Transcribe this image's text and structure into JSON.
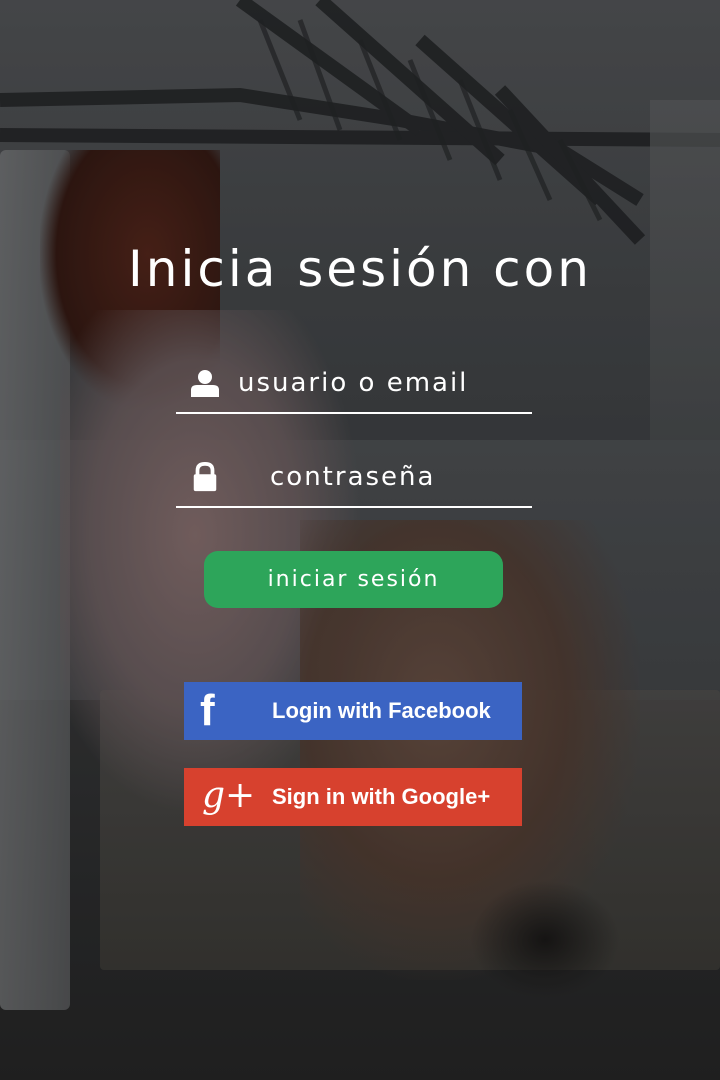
{
  "header": {
    "title": "Inicia sesión con"
  },
  "form": {
    "username": {
      "placeholder": "usuario o email",
      "icon": "user-icon"
    },
    "password": {
      "placeholder": "contraseña",
      "icon": "lock-icon"
    },
    "submit_label": "iniciar sesión"
  },
  "social": {
    "facebook": {
      "label": "Login with Facebook",
      "icon": "facebook-icon",
      "glyph": "f"
    },
    "google": {
      "label": "Sign in with Google+",
      "icon": "google-plus-icon",
      "glyph": "g+"
    }
  },
  "colors": {
    "accent_green": "#2da55a",
    "facebook_blue": "#3b64c3",
    "google_red": "#d7412e",
    "text": "#ffffff"
  }
}
